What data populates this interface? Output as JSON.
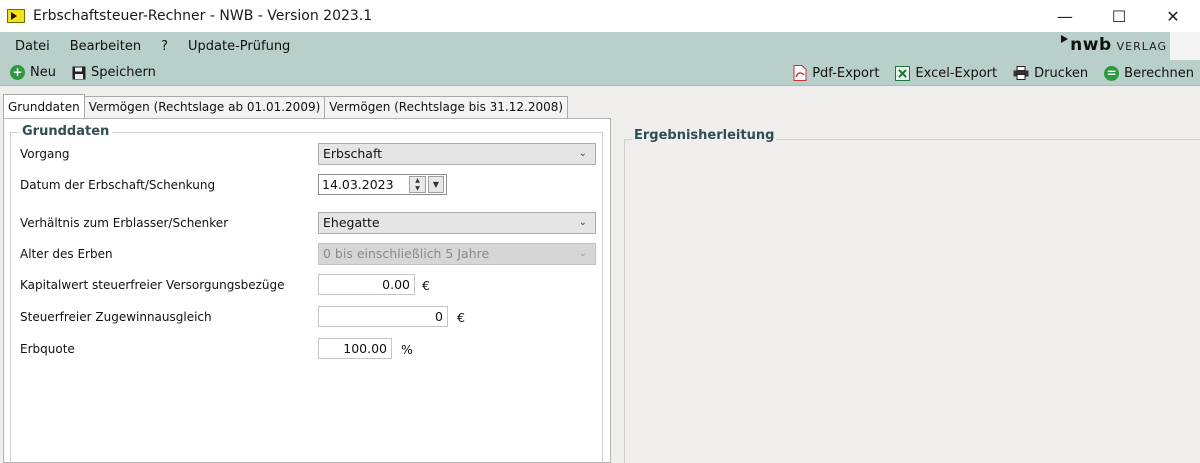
{
  "window": {
    "title": "Erbschaftsteuer-Rechner  - NWB - Version 2023.1",
    "minimize": "—",
    "maximize": "☐",
    "close": "✕"
  },
  "menu": {
    "items": [
      "Datei",
      "Bearbeiten",
      "?",
      "Update-Prüfung"
    ]
  },
  "brand": {
    "name": "nwb",
    "suffix": "VERLAG"
  },
  "toolbar": {
    "new_label": "Neu",
    "save_label": "Speichern",
    "pdf_label": "Pdf-Export",
    "excel_label": "Excel-Export",
    "print_label": "Drucken",
    "calc_label": "Berechnen"
  },
  "tabs": [
    {
      "label": "Grunddaten",
      "active": true
    },
    {
      "label": "Vermögen (Rechtslage ab 01.01.2009)",
      "active": false
    },
    {
      "label": "Vermögen (Rechtslage bis 31.12.2008)",
      "active": false
    }
  ],
  "form": {
    "group_title": "Grunddaten",
    "vorgang_label": "Vorgang",
    "vorgang_value": "Erbschaft",
    "datum_label": "Datum der Erbschaft/Schenkung",
    "datum_value": "14.03.2023",
    "verhaeltnis_label": "Verhältnis zum Erblasser/Schenker",
    "verhaeltnis_value": "Ehegatte",
    "alter_label": "Alter des Erben",
    "alter_value": "0 bis einschließlich 5 Jahre",
    "kapitalwert_label": "Kapitalwert steuerfreier Versorgungsbezüge",
    "kapitalwert_value": "0.00",
    "kapitalwert_unit": "€",
    "zugewinn_label": "Steuerfreier Zugewinnausgleich",
    "zugewinn_value": "0",
    "zugewinn_unit": "€",
    "erbquote_label": "Erbquote",
    "erbquote_value": "100.00",
    "erbquote_unit": "%"
  },
  "results": {
    "title": "Ergebnisherleitung"
  },
  "colors": {
    "chrome": "#b9cfca",
    "accent_green": "#2e9a3f",
    "group_title": "#2f4e52"
  }
}
